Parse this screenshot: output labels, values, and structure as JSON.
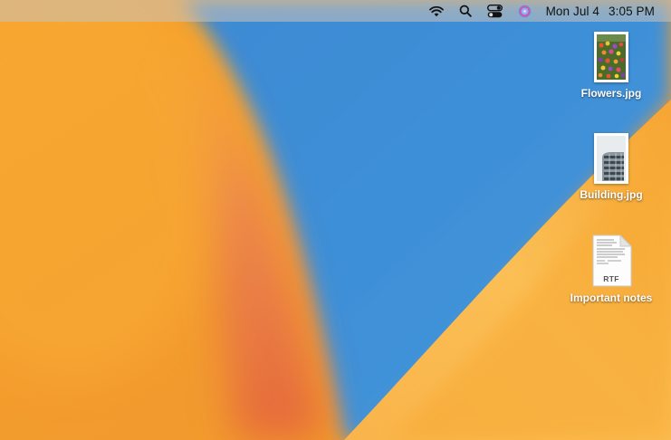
{
  "menubar": {
    "status_icons": [
      "wifi-icon",
      "search-icon",
      "control-center-icon",
      "siri-icon"
    ],
    "date": "Mon Jul 4",
    "time": "3:05 PM"
  },
  "desktop": {
    "wallpaper": {
      "colors": [
        "#f7a62b",
        "#e8734a",
        "#3b8fd6",
        "#fbbf52"
      ]
    },
    "icons": [
      {
        "label": "Flowers.jpg",
        "kind": "image-thumbnail"
      },
      {
        "label": "Building.jpg",
        "kind": "image-thumbnail"
      },
      {
        "label": "Important notes",
        "kind": "rtf-document",
        "badge": "RTF"
      }
    ]
  }
}
